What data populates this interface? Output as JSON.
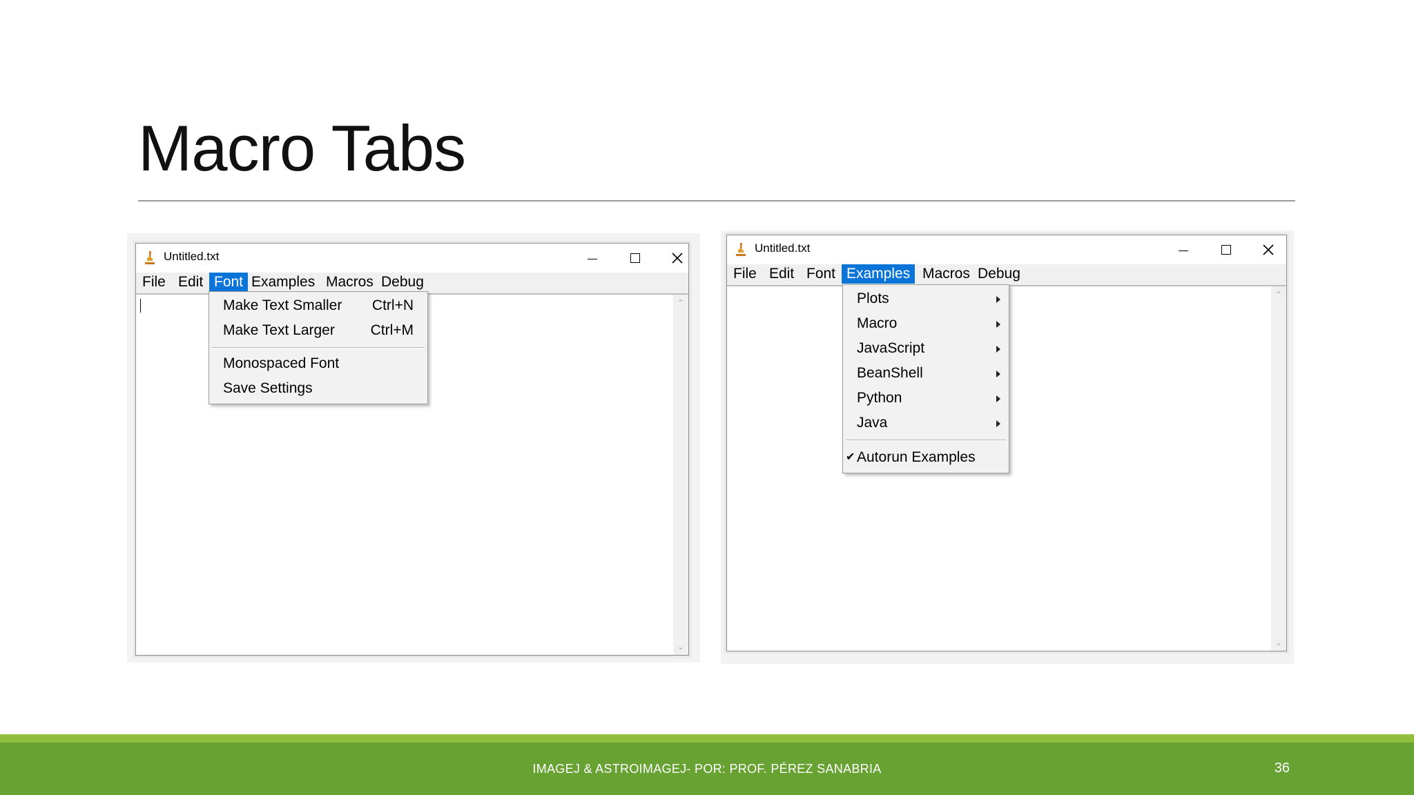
{
  "slide": {
    "title": "Macro Tabs",
    "footer": "IMAGEJ & ASTROIMAGEJ- POR: PROF. PÉREZ SANABRIA",
    "page_number": "36"
  },
  "colors": {
    "accent_blue": "#0a74d8",
    "footer_green": "#67a233",
    "footer_light_green": "#8fbf3c"
  },
  "left_window": {
    "title": "Untitled.txt",
    "icon": "imagej-microscope-icon",
    "controls": {
      "minimize_icon": "minimize-icon",
      "maximize_icon": "maximize-icon",
      "close_icon": "close-icon"
    },
    "menus": [
      "File",
      "Edit",
      "Font",
      "Examples",
      "Macros",
      "Debug"
    ],
    "active_menu": "Font",
    "dropdown": {
      "items": [
        {
          "label": "Make Text Smaller",
          "shortcut": "Ctrl+N"
        },
        {
          "label": "Make Text Larger",
          "shortcut": "Ctrl+M"
        },
        {
          "label": "Monospaced Font",
          "shortcut": ""
        },
        {
          "label": "Save Settings",
          "shortcut": ""
        }
      ]
    }
  },
  "right_window": {
    "title": "Untitled.txt",
    "icon": "imagej-microscope-icon",
    "controls": {
      "minimize_icon": "minimize-icon",
      "maximize_icon": "maximize-icon",
      "close_icon": "close-icon"
    },
    "menus": [
      "File",
      "Edit",
      "Font",
      "Examples",
      "Macros",
      "Debug"
    ],
    "active_menu": "Examples",
    "dropdown": {
      "submenus": [
        "Plots",
        "Macro",
        "JavaScript",
        "BeanShell",
        "Python",
        "Java"
      ],
      "checked_item": {
        "label": "Autorun Examples",
        "checked": true
      }
    }
  }
}
